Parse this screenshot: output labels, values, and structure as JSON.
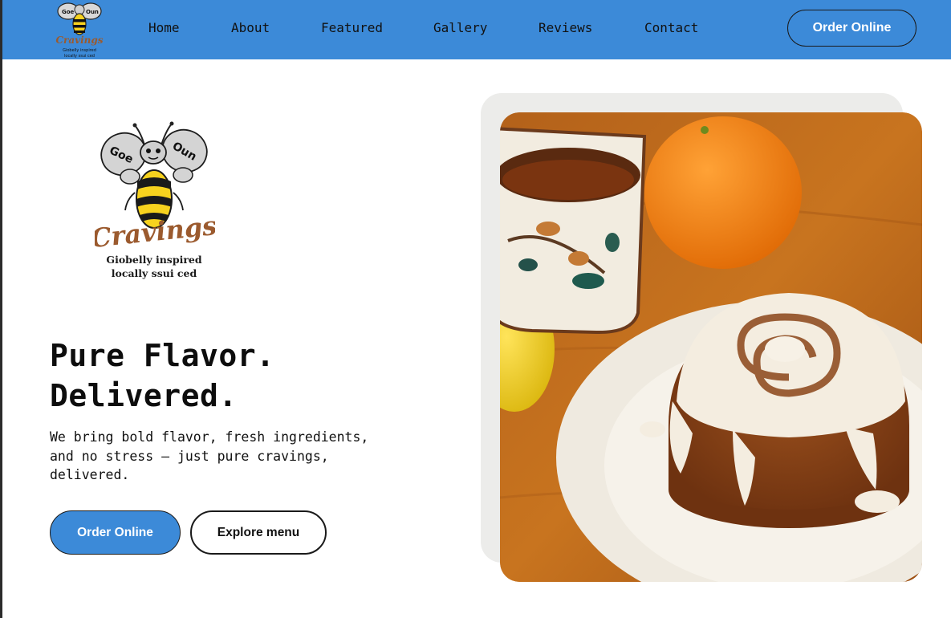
{
  "nav": {
    "logo_text_top_left": "Goe",
    "logo_text_top_right": "Oun",
    "logo_brand": "Cravings",
    "logo_tagline_1": "Giobelly inspired",
    "logo_tagline_2": "locally ssui ced",
    "links": [
      "Home",
      "About",
      "Featured",
      "Gallery",
      "Reviews",
      "Contact"
    ],
    "order_label": "Order Online"
  },
  "hero": {
    "logo": {
      "wing_left": "Goe",
      "wing_right": "Oun",
      "brand": "Cravings",
      "tagline_1": "Giobelly inspired",
      "tagline_2": "locally ssui ced"
    },
    "title_line_1": "Pure Flavor.",
    "title_line_2": "Delivered.",
    "description": "We bring bold flavor, fresh ingredients, and no stress — just pure cravings, delivered.",
    "primary_button": "Order Online",
    "secondary_button": "Explore menu"
  },
  "colors": {
    "brand_blue": "#3c8ad8",
    "brand_brown": "#9b5a2e",
    "bee_yellow": "#f7d21e",
    "text_dark": "#0d0d0d"
  }
}
